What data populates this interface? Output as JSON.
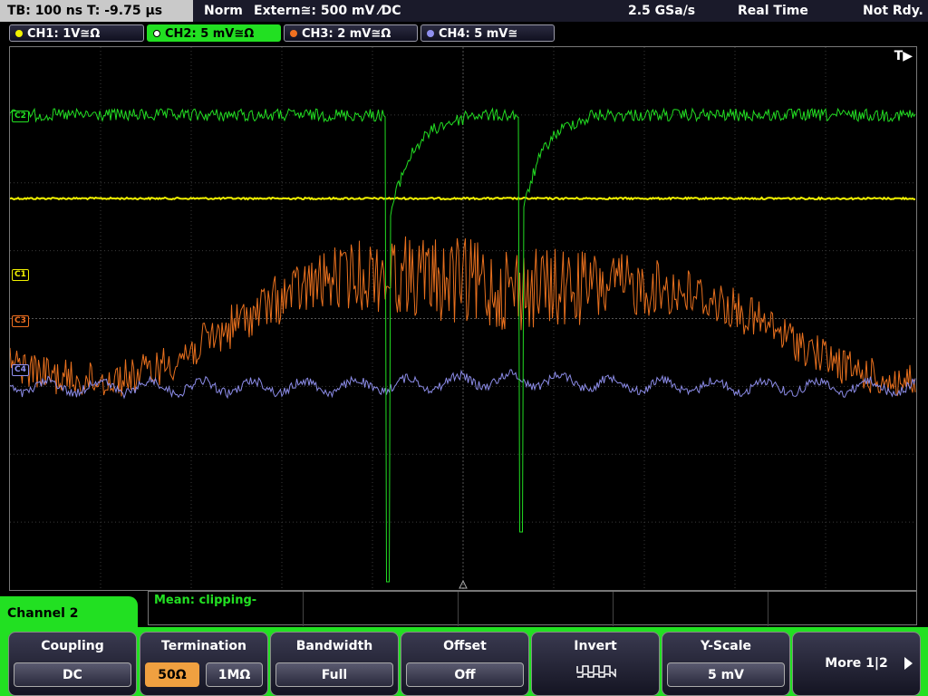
{
  "topbar": {
    "timebase": "TB: 100 ns   T: -9.75 µs",
    "mode": "Norm",
    "trigger": "Extern≅: 500 mV ⁄DC",
    "sample_rate": "2.5 GSa/s",
    "acq_mode": "Real Time",
    "status": "Not Rdy."
  },
  "channels": [
    {
      "label": "CH1: 1V≅Ω",
      "color": "#f2f200"
    },
    {
      "label": "CH2: 5 mV≅Ω",
      "color": "#22e022"
    },
    {
      "label": "CH3: 2 mV≅Ω",
      "color": "#f07020"
    },
    {
      "label": "CH4: 5 mV≅",
      "color": "#9090f0"
    }
  ],
  "screen": {
    "trigger_marker": "T▶",
    "markers": {
      "c2": "C2",
      "c1": "C1",
      "c3": "C3",
      "c4": "C4"
    }
  },
  "measurement": {
    "text": "Mean: clipping-"
  },
  "menu": {
    "title": "Channel 2",
    "coupling": {
      "title": "Coupling",
      "value": "DC"
    },
    "termination": {
      "title": "Termination",
      "opt1": "50Ω",
      "opt2": "1MΩ"
    },
    "bandwidth": {
      "title": "Bandwidth",
      "value": "Full"
    },
    "offset": {
      "title": "Offset",
      "value": "Off"
    },
    "invert": {
      "title": "Invert"
    },
    "yscale": {
      "title": "Y-Scale",
      "value": "5 mV"
    },
    "more": {
      "title": "More 1|2"
    }
  }
}
